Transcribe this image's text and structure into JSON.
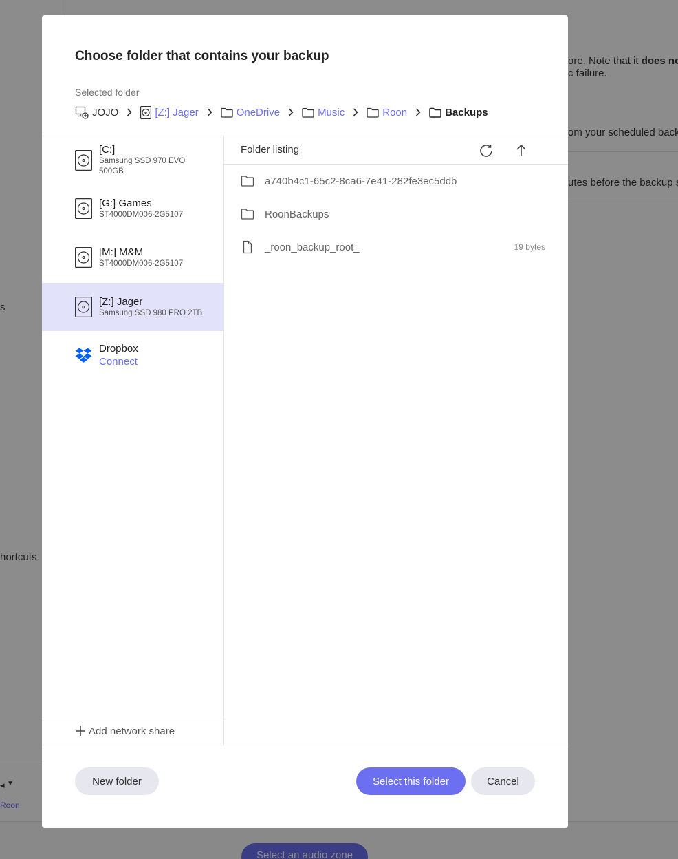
{
  "background": {
    "text_line1": "ore. Note that it ",
    "text_line1_bold": "does no",
    "text_line2": "c failure.",
    "text_line3": "om your scheduled backu",
    "text_line4": "utes before the backup s",
    "left_frag1": "s",
    "left_frag2": "hortcuts",
    "left_footer_link": "Roon",
    "zone_button": "Select an audio zone"
  },
  "dialog": {
    "title": "Choose folder that contains your backup",
    "selected_label": "Selected folder",
    "breadcrumb": [
      {
        "label": "JOJO",
        "icon": "computer-icon"
      },
      {
        "label": "[Z:] Jager",
        "icon": "drive-icon"
      },
      {
        "label": "OneDrive",
        "icon": "folder-icon"
      },
      {
        "label": "Music",
        "icon": "folder-icon"
      },
      {
        "label": "Roon",
        "icon": "folder-icon"
      },
      {
        "label": "Backups",
        "icon": "folder-icon"
      }
    ],
    "drives": [
      {
        "name": "[C:]",
        "sub": "Samsung SSD 970 EVO 500GB"
      },
      {
        "name": "[G:] Games",
        "sub": "ST4000DM006-2G5107"
      },
      {
        "name": "[M:] M&M",
        "sub": "ST4000DM006-2G5107"
      },
      {
        "name": "[Z:] Jager",
        "sub": "Samsung SSD 980 PRO 2TB",
        "selected": true
      },
      {
        "name": "Dropbox",
        "connect": "Connect"
      }
    ],
    "add_share": "Add network share",
    "listing_title": "Folder listing",
    "entries": [
      {
        "name": "a740b4c1-65c2-8ca6-7e41-282fe3ec5ddb",
        "type": "folder",
        "size": ""
      },
      {
        "name": "RoonBackups",
        "type": "folder",
        "size": ""
      },
      {
        "name": "_roon_backup_root_",
        "type": "file",
        "size": "19 bytes"
      }
    ],
    "buttons": {
      "new_folder": "New folder",
      "select": "Select this folder",
      "cancel": "Cancel"
    },
    "accent_color": "#6c6ff0"
  }
}
